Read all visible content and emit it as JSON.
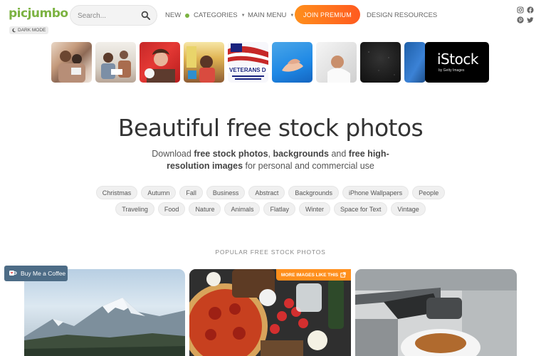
{
  "header": {
    "logo_text": "picjumbo",
    "dark_mode_label": "DARK MODE",
    "search_placeholder": "Search...",
    "nav": {
      "new_label": "NEW",
      "categories_label": "CATEGORIES",
      "main_menu_label": "MAIN MENU",
      "premium_label": "JOIN PREMIUM",
      "design_resources_label": "DESIGN RESOURCES"
    },
    "social_icons": [
      "instagram-icon",
      "facebook-icon",
      "pinterest-icon",
      "twitter-icon"
    ]
  },
  "thumbnails": [
    {
      "alt": "family-photo"
    },
    {
      "alt": "kids-reading-photo"
    },
    {
      "alt": "couple-red-photo"
    },
    {
      "alt": "toddler-photo"
    },
    {
      "alt": "veterans-day-photo",
      "caption": "VETERANS D"
    },
    {
      "alt": "hands-blue-photo"
    },
    {
      "alt": "baby-photo"
    },
    {
      "alt": "dark-texture-photo"
    },
    {
      "alt": "blue-photo"
    }
  ],
  "istock_ad": {
    "brand": "iStock",
    "byline": "by Getty Images"
  },
  "hero": {
    "title": "Beautiful free stock photos",
    "subtitle_pre": "Download ",
    "subtitle_b1": "free stock photos",
    "subtitle_sep1": ", ",
    "subtitle_b2": "backgrounds",
    "subtitle_and": " and ",
    "subtitle_b3": "free high-resolution images",
    "subtitle_post": " for personal and commercial use"
  },
  "tags_row1": [
    "Christmas",
    "Autumn",
    "Fall",
    "Business",
    "Abstract",
    "Backgrounds",
    "iPhone Wallpapers",
    "People"
  ],
  "tags_row2": [
    "Traveling",
    "Food",
    "Nature",
    "Animals",
    "Flatlay",
    "Winter",
    "Space for Text",
    "Vintage"
  ],
  "popular_heading": "POPULAR FREE STOCK PHOTOS",
  "buy_coffee_label": "Buy Me a Coffee",
  "more_images_label": "MORE IMAGES LIKE THIS",
  "colors": {
    "brand_green": "#7cb342",
    "premium_orange": "#ff8f1c",
    "coffee_blue": "#4d6c86"
  }
}
